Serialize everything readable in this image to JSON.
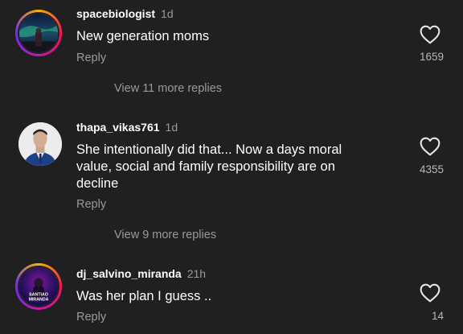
{
  "comments": [
    {
      "username": "spacebiologist",
      "age": "1d",
      "text": "New generation moms",
      "reply_label": "Reply",
      "likes": "1659",
      "more_replies": "View 11 more replies"
    },
    {
      "username": "thapa_vikas761",
      "age": "1d",
      "text": "She intentionally did that... Now a days moral value, social and family responsibility are on decline",
      "reply_label": "Reply",
      "likes": "4355",
      "more_replies": "View 9 more replies"
    },
    {
      "username": "dj_salvino_miranda",
      "age": "21h",
      "text": "Was her plan I guess ..",
      "reply_label": "Reply",
      "likes": "14",
      "avatar_text": [
        "SANTIAO",
        "MIRANDA"
      ]
    }
  ],
  "icons": {
    "like": "heart-outline-icon"
  },
  "colors": {
    "background": "#202020",
    "secondary_text": "#9a9a9a"
  }
}
